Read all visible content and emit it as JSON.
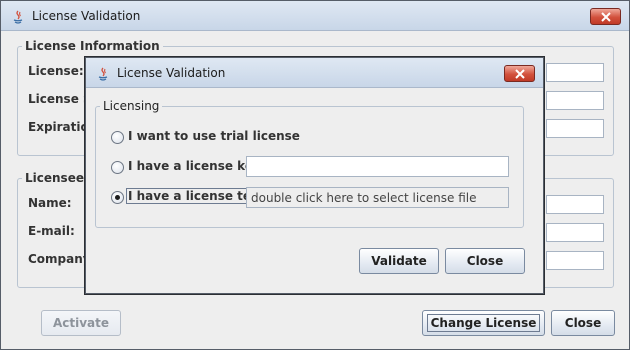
{
  "main_window": {
    "title": "License Validation",
    "license_info": {
      "group_title": "License Information",
      "license_label": "License:",
      "status_label": "License St",
      "expiration_label": "Expiration"
    },
    "licensee_info": {
      "group_title": "Licensee In",
      "name_label": "Name:",
      "email_label": "E-mail:",
      "company_label": "Company:"
    },
    "buttons": {
      "activate": "Activate",
      "change_license": "Change License",
      "close": "Close"
    }
  },
  "dialog": {
    "title": "License Validation",
    "group_title": "Licensing",
    "options": [
      {
        "label": "I want to use trial license",
        "selected": false
      },
      {
        "label": "I have a license key",
        "selected": false
      },
      {
        "label": "I have a license text",
        "selected": true
      }
    ],
    "license_key_value": "",
    "license_text_hint": "double click here to select license file",
    "buttons": {
      "validate": "Validate",
      "close": "Close"
    }
  },
  "colors": {
    "title_close_red": "#d2513d",
    "window_bg": "#eeeeee",
    "border": "#565d68"
  }
}
